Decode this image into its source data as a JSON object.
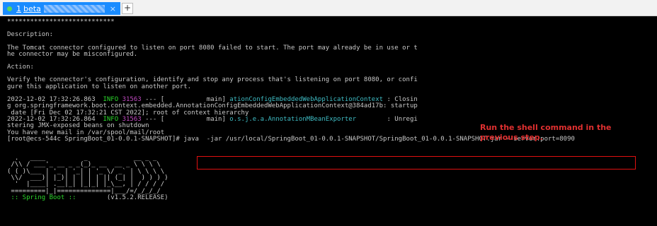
{
  "tab": {
    "number": "1",
    "label": "beta",
    "close": "×"
  },
  "new_tab": "+",
  "lines": {
    "l0": "****************************",
    "l1": "Description:",
    "l2": "The Tomcat connector configured to listen on port 8080 failed to start. The port may already be in use or t",
    "l3": "he connector may be misconfigured.",
    "l4": "Action:",
    "l5": "Verify the connector's configuration, identify and stop any process that's listening on port 8080, or confi",
    "l6": "gure this application to listen on another port.",
    "l7a": "2022-12-02 17:32:26.863  ",
    "l7b": "INFO",
    "l7c": " 31563",
    "l7d": " --- [           main] ",
    "l7e": "ationConfigEmbeddedWebApplicationContext",
    "l7f": " : Closin",
    "l8": "g org.springframework.boot.context.embedded.AnnotationConfigEmbeddedWebApplicationContext@384ad17b: startup",
    "l9": " date [Fri Dec 02 17:32:21 CST 2022]; root of context hierarchy",
    "l10a": "2022-12-02 17:32:26.864  ",
    "l10b": "INFO",
    "l10c": " 31563",
    "l10d": " --- [           main] ",
    "l10e": "o.s.j.e.a.AnnotationMBeanExporter",
    "l10f": "        : Unregi",
    "l11": "stering JMX-exposed beans on shutdown",
    "l12": "You have new mail in /var/spool/mail/root",
    "l13": "[root@ecs-544c SpringBoot_01-0.0.1-SNAPSHOT]# java  -jar /usr/local/SpringBoot_01-0.0.1-SNAPSHOT/SpringBoot_01-0.0.1-SNAPSHOT.jar --server.port=8090"
  },
  "ascii": {
    "a0": "  .   ____          _            __ _ _",
    "a1": " /\\\\ / ___'_ __ _ _(_)_ __  __ _ \\ \\ \\ \\",
    "a2": "( ( )\\___ | '_ | '_| | '_ \\/ _` | \\ \\ \\ \\",
    "a3": " \\\\/  ___)| |_)| | | | | || (_| |  ) ) ) )",
    "a4": "  '  |____| .__|_| |_|_| |_\\__, | / / / /",
    "a5": " =========|_|==============|___/=/_/_/_/",
    "a6a": " :: Spring Boot :: ",
    "a6b": "       (v1.5.2.RELEASE)"
  },
  "annotation": {
    "line1": "Run the shell command in the",
    "line2": "previous step."
  },
  "colors": {
    "info": "#2bd62b",
    "pid": "#c04ac0",
    "logger": "#3fbcc4",
    "annotation": "#e03030",
    "highlight_box": "#e01010"
  }
}
